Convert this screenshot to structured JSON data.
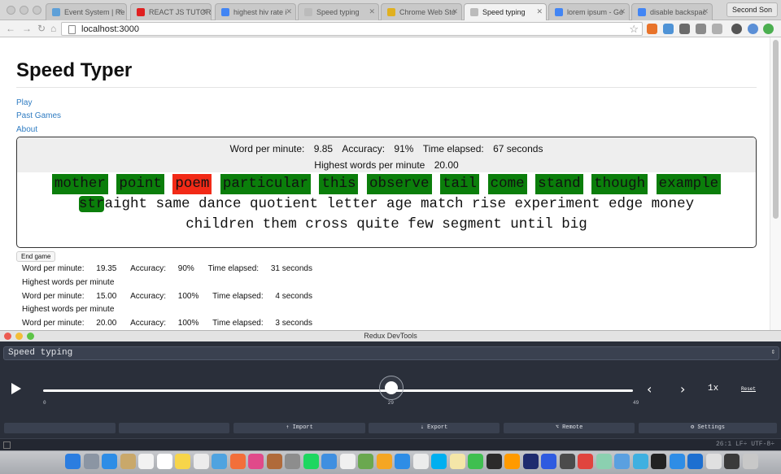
{
  "browser": {
    "tabs": [
      {
        "label": "Event System | Re",
        "color": "#5ea0d8"
      },
      {
        "label": "REACT JS TUTORI",
        "color": "#e02020"
      },
      {
        "label": "highest hiv rate i",
        "color": "#4285f4"
      },
      {
        "label": "Speed typing",
        "color": "#bbbbbb"
      },
      {
        "label": "Chrome Web Sto",
        "color": "#e0b020"
      },
      {
        "label": "Speed typing",
        "color": "#bbbbbb"
      },
      {
        "label": "lorem ipsum - Go",
        "color": "#4285f4"
      },
      {
        "label": "disable backspac",
        "color": "#4285f4"
      }
    ],
    "profile": "Second Son",
    "url": "localhost:3000"
  },
  "page": {
    "title": "Speed Typer",
    "nav": [
      "Play",
      "Past Games",
      "About"
    ],
    "stats": {
      "wpm_label": "Word per minute:",
      "wpm": "9.85",
      "acc_label": "Accuracy:",
      "acc": "91%",
      "time_label": "Time elapsed:",
      "time": "67 seconds",
      "highest_label": "Highest words per minute",
      "highest": "20.00"
    },
    "typed_words": [
      {
        "w": "mother",
        "s": "ok"
      },
      {
        "w": "point",
        "s": "ok"
      },
      {
        "w": "poem",
        "s": "bad"
      },
      {
        "w": "particular",
        "s": "ok"
      },
      {
        "w": "this",
        "s": "ok"
      },
      {
        "w": "observe",
        "s": "ok"
      },
      {
        "w": "tail",
        "s": "ok"
      },
      {
        "w": "come",
        "s": "ok"
      },
      {
        "w": "stand",
        "s": "ok"
      },
      {
        "w": "though",
        "s": "ok"
      },
      {
        "w": "example",
        "s": "ok"
      }
    ],
    "current_word_typed": "str",
    "current_word_rest": "aight",
    "remaining_words": "same dance quotient letter age match rise experiment edge money children them cross quite few segment until big",
    "end_game": "End game",
    "history": [
      {
        "wpm_label": "Word per minute:",
        "wpm": "19.35",
        "acc_label": "Accuracy:",
        "acc": "90%",
        "time_label": "Time elapsed:",
        "time": "31 seconds",
        "highest_label": "Highest words per minute"
      },
      {
        "wpm_label": "Word per minute:",
        "wpm": "15.00",
        "acc_label": "Accuracy:",
        "acc": "100%",
        "time_label": "Time elapsed:",
        "time": "4 seconds",
        "highest_label": "Highest words per minute"
      },
      {
        "wpm_label": "Word per minute:",
        "wpm": "20.00",
        "acc_label": "Accuracy:",
        "acc": "100%",
        "time_label": "Time elapsed:",
        "time": "3 seconds"
      }
    ]
  },
  "devtools": {
    "window_title": "Redux DevTools",
    "instance": "Speed typing",
    "slider_min": "0",
    "slider_value": "29",
    "slider_max": "49",
    "slider_fraction": 0.59,
    "speed": "1x",
    "reset": "Reset",
    "buttons": [
      "",
      "",
      "⇡ Import",
      "⇣ Export",
      "⌥ Remote",
      "⚙ Settings"
    ],
    "status": "26:1  LF÷  UTF-8÷"
  },
  "dock": {
    "colors": [
      "#2b7de0",
      "#8b95a3",
      "#2e8de6",
      "#c9a86a",
      "#f2f2f2",
      "#ffffff",
      "#f7d54a",
      "#ececec",
      "#4fa3e0",
      "#f26f3a",
      "#e04a8a",
      "#b06a3a",
      "#8d8d8d",
      "#1ed760",
      "#3f8fe0",
      "#f0f0f0",
      "#6aa84f",
      "#f5a623",
      "#2e8de6",
      "#ececec",
      "#00aff0",
      "#f4e6a8",
      "#3fbf50",
      "#2b2b2b",
      "#ff9a00",
      "#1e2b6e",
      "#2e5be0",
      "#4b4b4b",
      "#e0443e",
      "#8bd0b0",
      "#5aa0e0",
      "#3fb0e0",
      "#222222",
      "#2e8de6",
      "#1d6fd0",
      "#e0e0e0",
      "#3a3a3a",
      "#c8c8c8"
    ]
  }
}
